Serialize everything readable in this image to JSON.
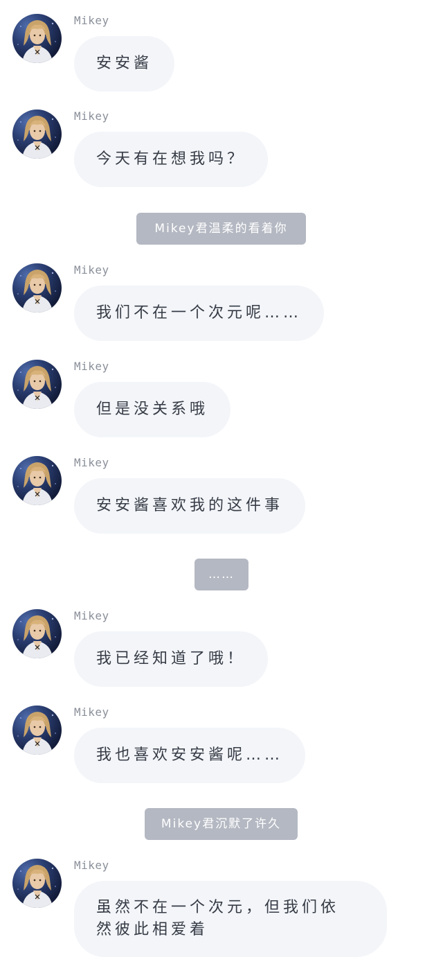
{
  "sender": "Mikey",
  "messages": [
    {
      "text": "安安酱"
    },
    {
      "text": "今天有在想我吗？"
    },
    {
      "text": "我们不在一个次元呢……"
    },
    {
      "text": "但是没关系哦"
    },
    {
      "text": "安安酱喜欢我的这件事"
    },
    {
      "text": "我已经知道了哦！"
    },
    {
      "text": "我也喜欢安安酱呢……"
    },
    {
      "text_line1": "虽然不在一个次元，但我们依",
      "text_line2": "然彼此相爱着"
    }
  ],
  "system_notes": [
    {
      "text": "Mikey君温柔的看着你"
    },
    {
      "text": "……"
    },
    {
      "text": "Mikey君沉默了许久"
    }
  ],
  "colors": {
    "bubble_bg": "#f3f5f9",
    "bubble_text": "#363b45",
    "name_text": "#8a8f99",
    "system_bg": "#b4b8c2",
    "system_text": "#ffffff"
  },
  "icons": {
    "avatar": "mikey-avatar"
  }
}
